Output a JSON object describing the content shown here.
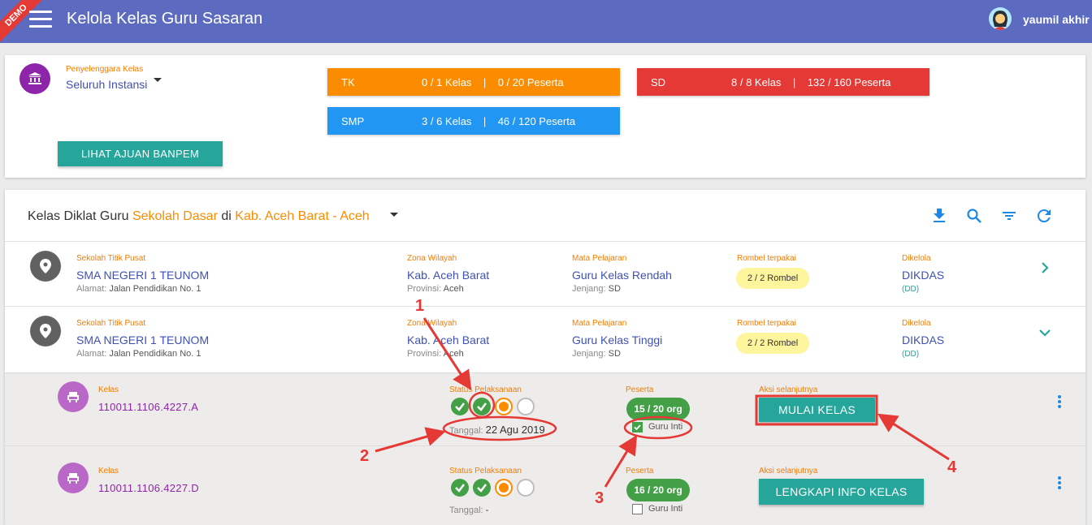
{
  "header": {
    "demo_badge": "DEMO",
    "title": "Kelola Kelas Guru Sasaran",
    "user_name": "yaumil akhir",
    "bar_color": "#5c6bc0"
  },
  "summary": {
    "penyelenggara_label": "Penyelenggara Kelas",
    "penyelenggara_value": "Seluruh Instansi",
    "stats": [
      {
        "name": "TK",
        "value": "0 / 1 Kelas    |    0 / 20 Peserta",
        "color": "#fb8c00"
      },
      {
        "name": "SD",
        "value": "8 / 8 Kelas    |    132 / 160 Peserta",
        "color": "#e53935"
      },
      {
        "name": "SMP",
        "value": "3 / 6 Kelas    |    46 / 120 Peserta",
        "color": "#2196f3"
      }
    ],
    "banpem_button": "LIHAT AJUAN BANPEM"
  },
  "list": {
    "heading_prefix": "Kelas Diklat Guru",
    "heading_level": "Sekolah Dasar",
    "heading_mid": "di",
    "heading_region": "Kab. Aceh Barat - Aceh",
    "toolbar": [
      "download-icon",
      "search-icon",
      "filter-icon",
      "refresh-icon"
    ],
    "labels": {
      "sekolah": "Sekolah Titik Pusat",
      "zona": "Zona Wilayah",
      "mapel": "Mata Pelajaran",
      "rombel": "Rombel terpakai",
      "dikelola": "Dikelola",
      "alamat": "Alamat:",
      "provinsi": "Provinsi:",
      "jenjang": "Jenjang:",
      "kelas": "Kelas",
      "status": "Status Pelaksanaan",
      "peserta": "Peserta",
      "aksi": "Aksi selanjutnya",
      "tanggal": "Tanggal:"
    },
    "groups": [
      {
        "school": "SMA NEGERI 1 TEUNOM",
        "address": "Jalan Pendidikan No. 1",
        "zona": "Kab. Aceh Barat",
        "provinsi": "Aceh",
        "mapel": "Guru Kelas Rendah",
        "jenjang": "SD",
        "rombel": "2 / 2 Rombel",
        "dikelola": "DIKDAS",
        "dikelola_sub": "(DD)",
        "expand_icon": "chevron-right-icon"
      },
      {
        "school": "SMA NEGERI 1 TEUNOM",
        "address": "Jalan Pendidikan No. 1",
        "zona": "Kab. Aceh Barat",
        "provinsi": "Aceh",
        "mapel": "Guru Kelas Tinggi",
        "jenjang": "SD",
        "rombel": "2 / 2 Rombel",
        "dikelola": "DIKDAS",
        "dikelola_sub": "(DD)",
        "expand_icon": "chevron-down-icon"
      }
    ],
    "classes": [
      {
        "kode": "110011.1106.4227.A",
        "steps": [
          "done",
          "done",
          "current",
          "todo"
        ],
        "tanggal": "22 Agu 2019",
        "peserta": "15 / 20 org",
        "guru_inti_label": "Guru Inti",
        "guru_inti_checked": true,
        "action": "MULAI KELAS"
      },
      {
        "kode": "110011.1106.4227.D",
        "steps": [
          "done",
          "done",
          "current",
          "todo"
        ],
        "tanggal": "-",
        "peserta": "16 / 20 org",
        "guru_inti_label": "Guru Inti",
        "guru_inti_checked": false,
        "action": "LENGKAPI INFO KELAS"
      }
    ]
  },
  "annotations": [
    "1",
    "2",
    "3",
    "4"
  ]
}
